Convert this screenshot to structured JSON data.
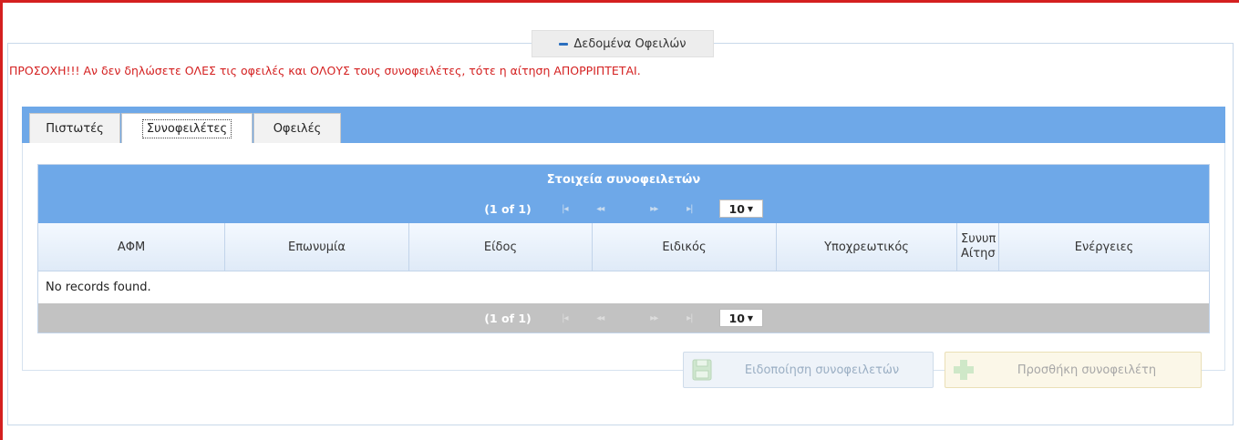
{
  "panel": {
    "legend_title": "Δεδομένα Οφειλών",
    "warning": "ΠΡΟΣΟΧΗ!!! Αν δεν δηλώσετε ΟΛΕΣ τις οφειλές και ΟΛΟΥΣ τους συνοφειλέτες, τότε η αίτηση ΑΠΟΡΡΙΠΤΕΤΑΙ."
  },
  "tabs": [
    {
      "label": "Πιστωτές"
    },
    {
      "label": "Συνοφειλέτες"
    },
    {
      "label": "Οφειλές"
    }
  ],
  "active_tab": "Συνοφειλέτες",
  "table": {
    "title": "Στοιχεία συνοφειλετών",
    "page_status": "(1 of 1)",
    "first_glyph": "|◂",
    "prev_glyph": "◂◂",
    "next_glyph": "▸▸",
    "last_glyph": "▸|",
    "rows_per_page": "10",
    "columns": [
      {
        "label": "ΑΦΜ"
      },
      {
        "label": "Επωνυμία"
      },
      {
        "label": "Είδος"
      },
      {
        "label": "Ειδικός"
      },
      {
        "label": "Υποχρεωτικός"
      },
      {
        "label_line1": "Συνυπ",
        "label_line2": "Αίτησ"
      },
      {
        "label": "Ενέργειες"
      }
    ],
    "empty_message": "No records found."
  },
  "buttons": {
    "notify_label": "Ειδοποίηση συνοφειλετών",
    "add_label": "Προσθήκη συνοφειλέτη"
  },
  "colors": {
    "warning_red": "#d42020",
    "header_blue": "#6ea8e8",
    "footer_gray": "#c2c2c2"
  },
  "icons": {
    "legend": "minus-icon",
    "notify": "save-disk-icon",
    "add": "plus-icon",
    "dropdown": "caret-down-icon"
  }
}
